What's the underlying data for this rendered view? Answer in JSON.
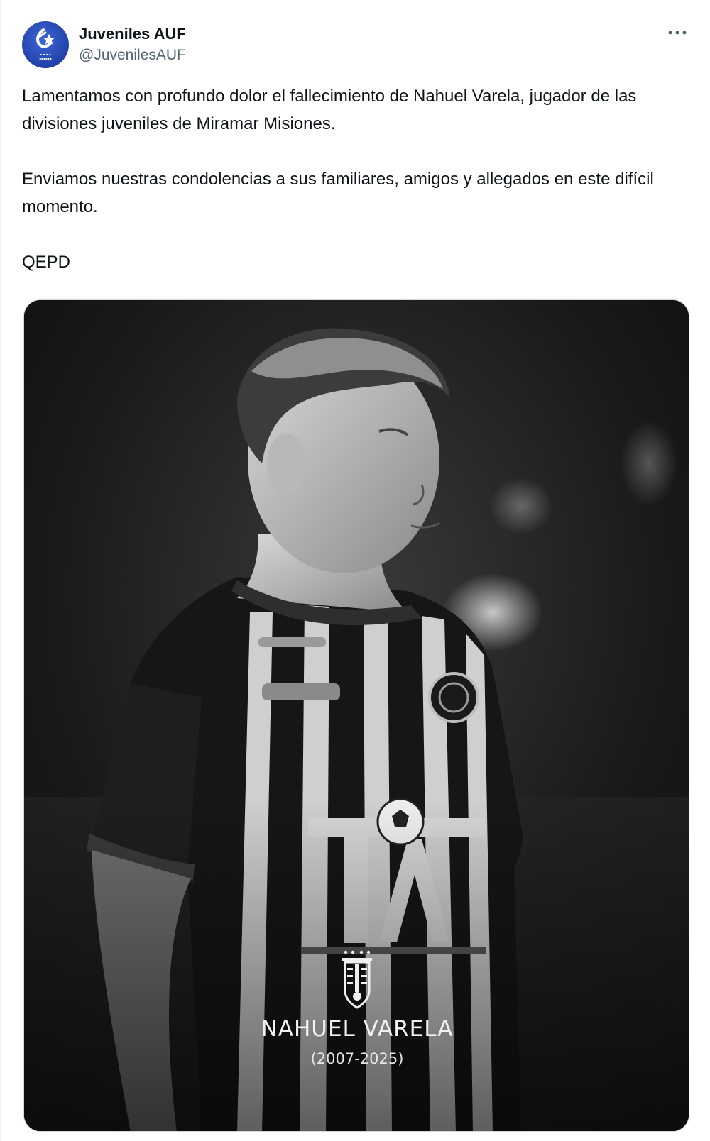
{
  "account": {
    "display_name": "Juveniles AUF",
    "handle": "@JuvenilesAUF",
    "avatar_icon": "juveniles-auf-logo"
  },
  "more_menu": {
    "icon": "more-horizontal-icon"
  },
  "post": {
    "paragraphs": [
      "Lamentamos con profundo dolor el fallecimiento de Nahuel Varela, jugador de las divisiones juveniles de Miramar Misiones.",
      "Enviamos nuestras condolencias a sus familiares, amigos y allegados en este difícil momento.",
      "QEPD"
    ]
  },
  "media": {
    "tribute_name": "NAHUEL VARELA",
    "tribute_years": "(2007-2025)",
    "crest_icon": "auf-crest-icon",
    "colors": {
      "background": "#101010",
      "text": "#f2f2f2"
    }
  }
}
